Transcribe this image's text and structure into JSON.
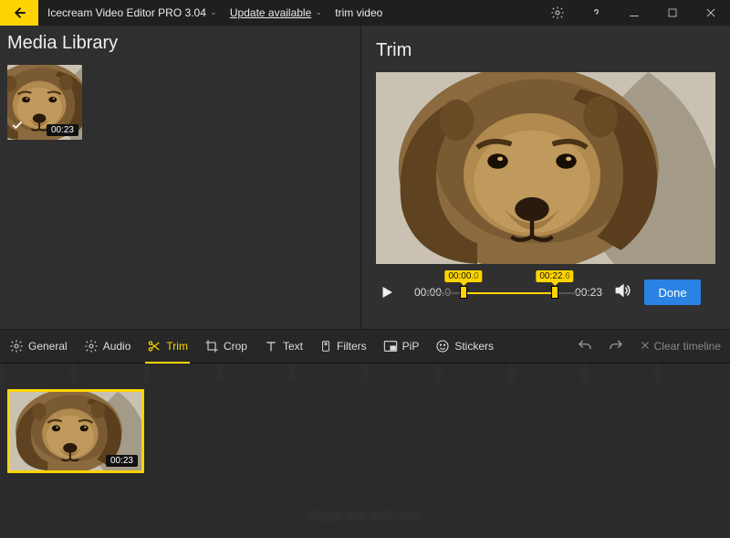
{
  "titlebar": {
    "app_name": "Icecream Video Editor PRO 3.04",
    "update_link": "Update available",
    "project_name": "trim video"
  },
  "media_library": {
    "title": "Media Library",
    "clips": [
      {
        "duration": "00:23"
      }
    ]
  },
  "trim": {
    "title": "Trim",
    "current_time_main": "00:00",
    "current_time_frac": ".0",
    "start_label_main": "00:00",
    "start_label_frac": ".0",
    "end_label_main": "00:22",
    "end_label_frac": ".6",
    "total_time": "00:23",
    "done_label": "Done"
  },
  "tools": {
    "general": "General",
    "audio": "Audio",
    "trim": "Trim",
    "crop": "Crop",
    "text": "Text",
    "filters": "Filters",
    "pip": "PiP",
    "stickers": "Stickers",
    "clear_timeline": "Clear timeline"
  },
  "timeline": {
    "clip_duration": "00:23",
    "audio_hint": "Drag & drop audio here"
  }
}
